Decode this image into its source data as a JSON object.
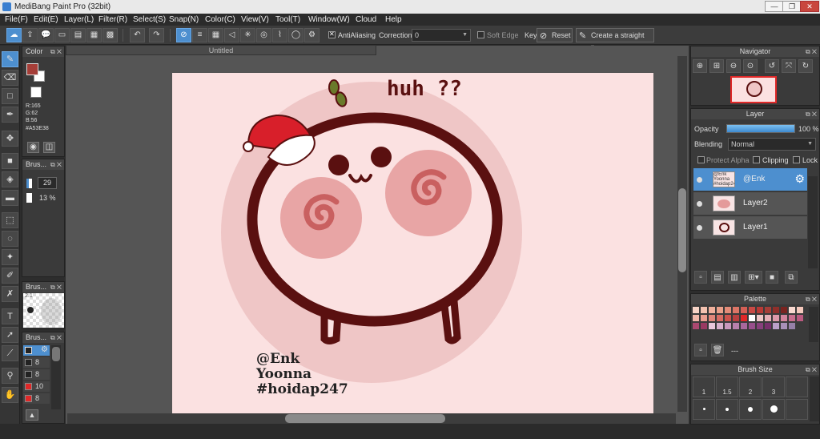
{
  "window": {
    "title": "MediBang Paint Pro (32bit)",
    "minimize": "—",
    "maximize": "❐",
    "close": "✕"
  },
  "menu": [
    "File(F)",
    "Edit(E)",
    "Layer(L)",
    "Filter(R)",
    "Select(S)",
    "Snap(N)",
    "Color(C)",
    "View(V)",
    "Tool(T)",
    "Window(W)",
    "Cloud",
    "Help"
  ],
  "toolbar": {
    "antialiasing_label": "AntiAliasing",
    "correction_label": "Correction",
    "correction_value": "0",
    "soft_edge_label": "Soft Edge",
    "key_label": "Key",
    "reset_label": "Reset",
    "straight_line_label": "Create a straight line"
  },
  "color_panel": {
    "title": "Color",
    "r": "R:165",
    "g": "G:62",
    "b": "B:56",
    "hex": "#A53E38",
    "fg_color": "#A53E38"
  },
  "brush_panel": {
    "title": "Brus...",
    "size": "29",
    "opacity": "13 %"
  },
  "brush_panel2": {
    "title": "Brus...",
    "preview_label": "2.1"
  },
  "brush_panel3": {
    "title": "Brus...",
    "items": [
      "",
      "8",
      "8",
      "10",
      "8"
    ]
  },
  "document": {
    "title": "Untitled"
  },
  "artwork": {
    "text_huh": "huh ??",
    "signature": [
      "@Enk",
      "Yoonna",
      "#hoidap247"
    ]
  },
  "navigator": {
    "title": "Navigator"
  },
  "layer_panel": {
    "title": "Layer",
    "opacity_label": "Opacity",
    "opacity_value": "100 %",
    "opacity_percent": 100,
    "blending_label": "Blending",
    "blending_value": "Normal",
    "protect_alpha": "Protect Alpha",
    "clipping": "Clipping",
    "lock": "Lock",
    "layers": [
      {
        "name": "@Enk",
        "thumb": "@Enk Yoonna #hoidap247"
      },
      {
        "name": "Layer2",
        "thumb": ""
      },
      {
        "name": "Layer1",
        "thumb": ""
      }
    ]
  },
  "palette_panel": {
    "title": "Palette",
    "name": "---"
  },
  "brush_size_panel": {
    "title": "Brush Size",
    "sizes": [
      "1",
      "1.5",
      "2",
      "3"
    ]
  }
}
